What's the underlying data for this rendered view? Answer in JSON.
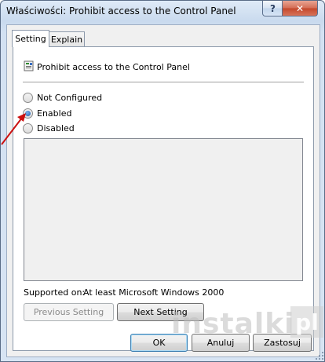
{
  "window": {
    "title": "Właściwości: Prohibit access to the Control Panel",
    "help_label": "?",
    "close_label": "✕"
  },
  "tabs": [
    {
      "label": "Setting",
      "active": true
    },
    {
      "label": "Explain",
      "active": false
    }
  ],
  "policy": {
    "icon": "policy-setting-icon",
    "name": "Prohibit access to the Control Panel"
  },
  "options": [
    {
      "label": "Not Configured",
      "checked": false
    },
    {
      "label": "Enabled",
      "checked": true
    },
    {
      "label": "Disabled",
      "checked": false
    }
  ],
  "supported": {
    "label": "Supported on:",
    "value": "At least Microsoft Windows 2000"
  },
  "nav_buttons": {
    "previous": "Previous Setting",
    "next": "Next Setting"
  },
  "dialog_buttons": {
    "ok": "OK",
    "cancel": "Anuluj",
    "apply": "Zastosuj"
  },
  "watermark": {
    "text": "instalki",
    "suffix": "pl"
  },
  "colors": {
    "arrow": "#cc1111",
    "accent": "#3c7fb1"
  }
}
